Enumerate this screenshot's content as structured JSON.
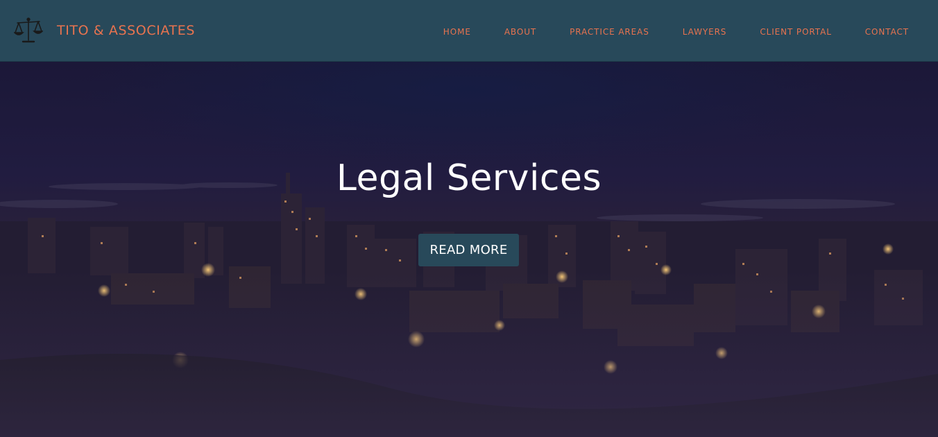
{
  "brand": {
    "name": "TITO & ASSOCIATES",
    "logo_icon": "scales-of-justice-icon"
  },
  "nav": {
    "items": [
      {
        "label": "HOME"
      },
      {
        "label": "ABOUT"
      },
      {
        "label": "PRACTICE AREAS"
      },
      {
        "label": "LAWYERS"
      },
      {
        "label": "CLIENT PORTAL"
      },
      {
        "label": "CONTACT"
      }
    ]
  },
  "hero": {
    "title": "Legal Services",
    "button_label": "READ MORE",
    "background": "night-city-skyline-image"
  },
  "colors": {
    "navbar_bg": "#28495a",
    "accent": "#e8734f",
    "button_bg": "#28495a",
    "hero_text": "#ffffff"
  }
}
